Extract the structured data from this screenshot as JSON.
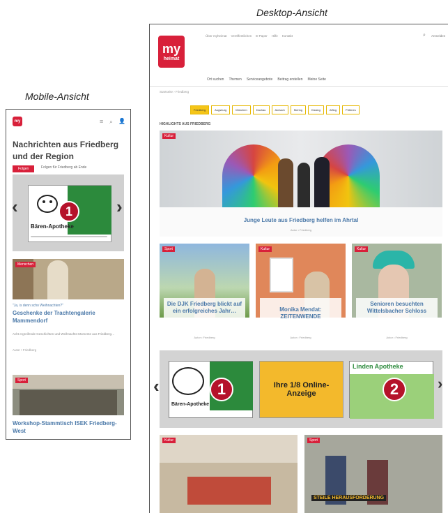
{
  "captions": {
    "mobile": "Mobile-Ansicht",
    "desktop": "Desktop-Ansicht"
  },
  "logo": {
    "line1": "my",
    "line2": "heimat"
  },
  "desktop": {
    "topnav": [
      "Über myheimat",
      "Veröffentlichen",
      "E-Paper",
      "Hilfe",
      "Kontakt"
    ],
    "mainnav": [
      "Ort suchen",
      "Themen",
      "Serviceangebote",
      "Beitrag erstellen",
      "Meine Seite"
    ],
    "user": "Anmelden",
    "breadcrumb": "Startseite › Friedberg",
    "chips": [
      "Friedberg",
      "Augsburg",
      "München",
      "Dachau",
      "Aichach",
      "Mering",
      "Kissing",
      "Affing",
      "Pöttmes"
    ],
    "section": "HIGHLIGHTS AUS FRIEDBERG",
    "hero": {
      "badge": "Kultur",
      "title": "Junge Leute aus Friedberg helfen im Ahrtal",
      "meta": "Autor • Friedberg"
    },
    "cards": [
      {
        "badge": "Sport",
        "title": "Die DJK Friedberg blickt auf ein erfolgreiches Jahr…",
        "meta": "Autor • Friedberg"
      },
      {
        "badge": "Kultur",
        "title": "Monika Mendat: ZEITENWENDE",
        "meta": "Autor • Friedberg"
      },
      {
        "badge": "Kultur",
        "title": "Senioren besuchten Wittelsbacher Schloss",
        "meta": "Autor • Friedberg"
      }
    ],
    "ad": {
      "text": "Ihre 1/8 Online-Anzeige",
      "num1": "1",
      "num2": "2",
      "pharmacy2": "Linden Apotheke"
    },
    "bottom": [
      {
        "badge": "Kultur"
      },
      {
        "badge": "Sport",
        "overlay": "STEILE HERAUSFORDERUNG"
      }
    ]
  },
  "mobile": {
    "heading": "Nachrichten aus Friedberg und der Region",
    "tag": "Folgen",
    "follow": "Folgen für Friedberg ab Ende",
    "ad": {
      "num": "1",
      "pharmacy": "Bären-Apotheke"
    },
    "article1": {
      "badge": "Menschen",
      "kicker": "\"Ja, is denn scho Weihnachten?\"",
      "title": "Geschenke der Trachtengalerie Mammendorf",
      "text": "Acht ergreifende Geschichten und Weihnachts-Momente aus Friedberg…",
      "meta": "Autor • Friedberg"
    },
    "article2": {
      "badge": "Sport",
      "title": "Workshop-Stammtisch ISEK Friedberg-West"
    }
  },
  "arrows": {
    "left": "‹",
    "right": "›"
  }
}
